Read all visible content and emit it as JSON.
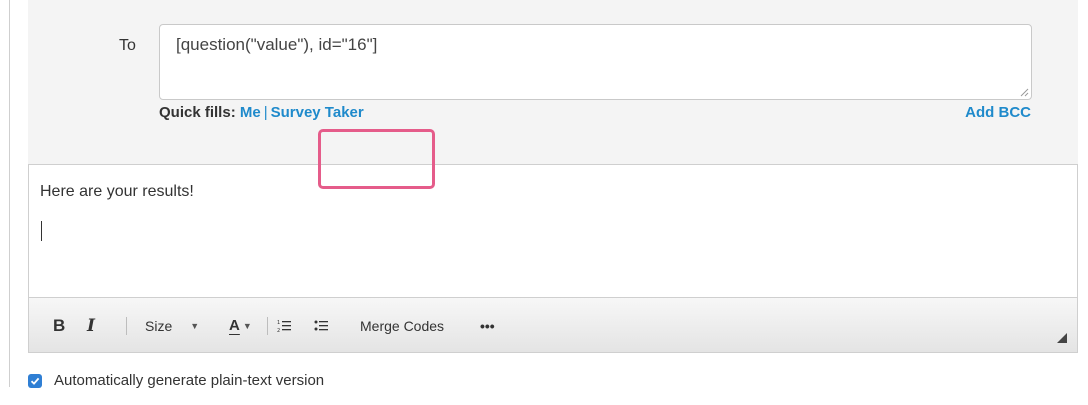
{
  "recipient": {
    "to_label": "To",
    "to_value": "[question(\"value\"), id=\"16\"]",
    "quick_fills_label": "Quick fills:",
    "quick_fill_links": [
      "Me",
      "Survey Taker"
    ],
    "separator": "|",
    "add_bcc_label": "Add BCC"
  },
  "editor": {
    "body_text": "Here are your results!",
    "toolbar": {
      "bold": "B",
      "italic": "I",
      "size_label": "Size",
      "font_color_glyph": "A",
      "ordered_list_icon": "ordered-list-icon",
      "bullet_list_icon": "bullet-list-icon",
      "merge_codes_label": "Merge Codes",
      "more_label": "•••"
    },
    "highlight_color": "#e55c8a"
  },
  "plain_text_option": {
    "checked": true,
    "label": "Automatically generate plain-text version"
  },
  "colors": {
    "link": "#1f8acb",
    "panel_bg": "#f4f4f4",
    "checkbox": "#2f7fd4"
  }
}
